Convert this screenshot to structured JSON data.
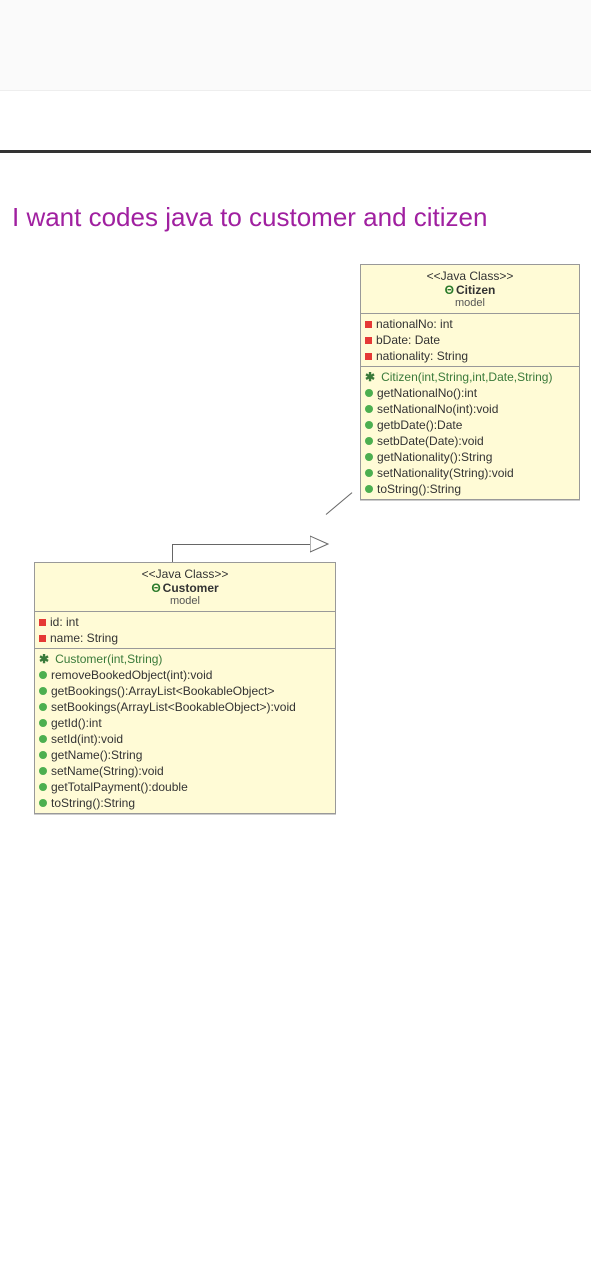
{
  "title": "I want codes java to customer and citizen",
  "citizen": {
    "stereotype": "<<Java Class>>",
    "name": "Citizen",
    "package": "model",
    "attributes": [
      {
        "vis": "priv",
        "text": "nationalNo: int"
      },
      {
        "vis": "priv",
        "text": "bDate: Date"
      },
      {
        "vis": "priv",
        "text": "nationality: String"
      }
    ],
    "operations": [
      {
        "ctor": true,
        "text": "Citizen(int,String,int,Date,String)"
      },
      {
        "vis": "pub",
        "text": "getNationalNo():int"
      },
      {
        "vis": "pub",
        "text": "setNationalNo(int):void"
      },
      {
        "vis": "pub",
        "text": "getbDate():Date"
      },
      {
        "vis": "pub",
        "text": "setbDate(Date):void"
      },
      {
        "vis": "pub",
        "text": "getNationality():String"
      },
      {
        "vis": "pub",
        "text": "setNationality(String):void"
      },
      {
        "vis": "pub",
        "text": "toString():String"
      }
    ]
  },
  "customer": {
    "stereotype": "<<Java Class>>",
    "name": "Customer",
    "package": "model",
    "attributes": [
      {
        "vis": "priv",
        "text": "id: int"
      },
      {
        "vis": "priv",
        "text": "name: String"
      }
    ],
    "operations": [
      {
        "ctor": true,
        "text": "Customer(int,String)"
      },
      {
        "vis": "pub",
        "text": "removeBookedObject(int):void"
      },
      {
        "vis": "pub",
        "text": "getBookings():ArrayList<BookableObject>"
      },
      {
        "vis": "pub",
        "text": "setBookings(ArrayList<BookableObject>):void"
      },
      {
        "vis": "pub",
        "text": "getId():int"
      },
      {
        "vis": "pub",
        "text": "setId(int):void"
      },
      {
        "vis": "pub",
        "text": "getName():String"
      },
      {
        "vis": "pub",
        "text": "setName(String):void"
      },
      {
        "vis": "pub",
        "text": "getTotalPayment():double"
      },
      {
        "vis": "pub",
        "text": "toString():String"
      }
    ]
  }
}
